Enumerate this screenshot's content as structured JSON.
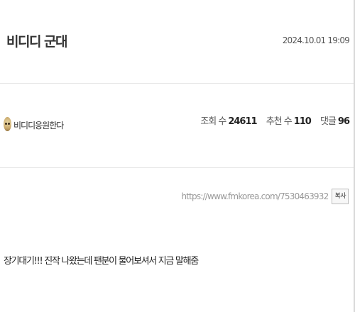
{
  "post": {
    "title": "비디디 군대",
    "date": "2024.10.01 19:09",
    "author": "비디디응원한다",
    "stats": {
      "views_label": "조회 수",
      "views": "24611",
      "likes_label": "추천 수",
      "likes": "110",
      "comments_label": "댓글",
      "comments": "96"
    },
    "url": "https://www.fmkorea.com/7530463932",
    "copy_label": "복사",
    "body": "장기대기!!! 진작 나왔는데 팬분이 물어보셔서 지금 말해줌"
  },
  "icons": {
    "avatar": "user-avatar-icon"
  }
}
